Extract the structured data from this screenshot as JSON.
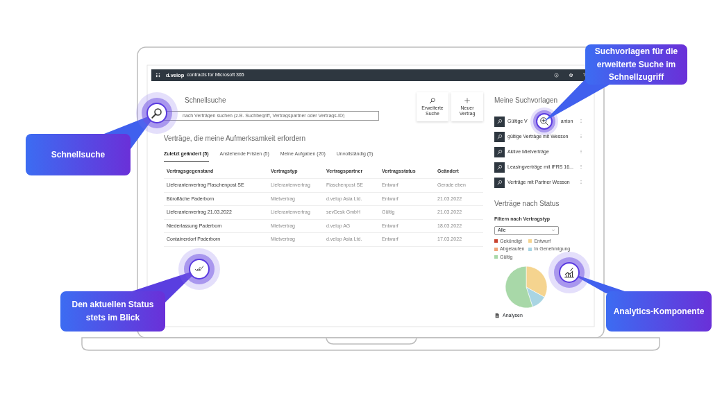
{
  "top_bar": {
    "logo": "d.velop",
    "product": "contracts for Microsoft 365",
    "help": "?"
  },
  "quick_search": {
    "title": "Schnellsuche",
    "placeholder": "nach Verträgen suchen (z.B. Suchbegriff, Vertragspartner oder Vertrags-ID)"
  },
  "actions": [
    {
      "kind": "search",
      "label": "Erweiterte Suche"
    },
    {
      "kind": "add",
      "label": "Neuer Vertrag"
    }
  ],
  "attention": {
    "title": "Verträge, die meine Aufmerksamkeit erfordern",
    "tabs": [
      {
        "label": "Zuletzt geändert (5)",
        "selected": true
      },
      {
        "label": "Anstehende Fristen (5)",
        "selected": false
      },
      {
        "label": "Meine Aufgaben (20)",
        "selected": false
      },
      {
        "label": "Unvollständig (5)",
        "selected": false
      }
    ],
    "table": {
      "columns": [
        "Vertragsgegenstand",
        "Vertragstyp",
        "Vertragspartner",
        "Vertragsstatus",
        "Geändert"
      ],
      "rows": [
        [
          "Lieferantenvertrag Flaschenpost SE",
          "Lieferantenvertrag",
          "Flaschenpost SE",
          "Entwurf",
          "Gerade eben"
        ],
        [
          "Bürofläche Paderborn",
          "Mietvertrag",
          "d.velop Asia Ltd.",
          "Entwurf",
          "21.03.2022"
        ],
        [
          "Lieferantenvertrag 21.03.2022",
          "Lieferantenvertrag",
          "sevDesk GmbH",
          "Gültig",
          "21.03.2022"
        ],
        [
          "Niederlassung Paderborn",
          "Mietvertrag",
          "d.velop AG",
          "Entwurf",
          "18.03.2022"
        ],
        [
          "Containerdorf Paderborn",
          "Mietvertrag",
          "d.velop Asia Ltd.",
          "Entwurf",
          "17.03.2022"
        ]
      ]
    }
  },
  "saved_searches": {
    "title": "Meine Suchvorlagen",
    "items": [
      {
        "label": "Gültige V",
        "label_end": "anton"
      },
      {
        "label": "gültige Verträge mit Wesson"
      },
      {
        "label": "Aktive Mietverträge"
      },
      {
        "label": "Leasingverträge mit IFRS 16..."
      },
      {
        "label": "Verträge mit Partner Wesson"
      }
    ]
  },
  "status": {
    "title": "Verträge nach Status",
    "filter_label": "Filtern nach Vertragstyp",
    "filter_value": "Alle",
    "legend": [
      {
        "label": "Gekündigt",
        "color": "#c8422e"
      },
      {
        "label": "Entwurf",
        "color": "#f5d48f"
      },
      {
        "label": "Abgelaufen",
        "color": "#f0a47a"
      },
      {
        "label": "In Genehmigung",
        "color": "#a9d5e3"
      },
      {
        "label": "Gültig",
        "color": "#a8d8a8"
      }
    ],
    "link": "Analysen"
  },
  "callouts": [
    {
      "kind": "search",
      "text": "Schnellsuche"
    },
    {
      "kind": "status",
      "text": "Den aktuellen Status stets im Blick"
    },
    {
      "kind": "templates",
      "text": "Suchvorlagen für die erweiterte Suche im Schnellzugriff"
    },
    {
      "kind": "analytics",
      "text": "Analytics-Komponente"
    }
  ]
}
